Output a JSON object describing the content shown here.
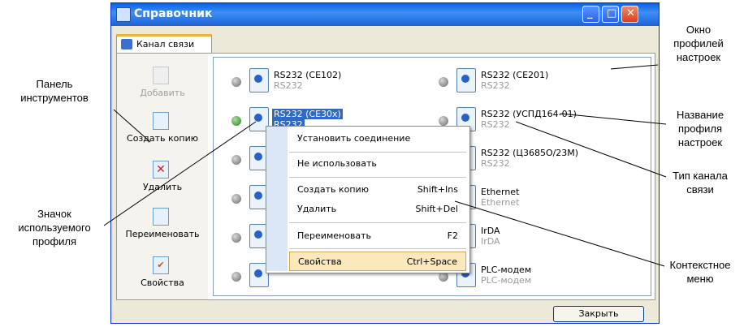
{
  "window": {
    "title": "Справочник",
    "close_label": "Закрыть"
  },
  "tab": {
    "label": "Канал связи"
  },
  "toolbar": [
    {
      "label": "Добавить",
      "disabled": true,
      "icon": "add-icon"
    },
    {
      "label": "Создать копию",
      "icon": "copy-icon"
    },
    {
      "label": "Удалить",
      "icon": "delete-icon"
    },
    {
      "label": "Переименовать",
      "icon": "rename-icon"
    },
    {
      "label": "Свойства",
      "icon": "properties-icon"
    }
  ],
  "profiles_left": [
    {
      "name": "RS232 (CE102)",
      "type": "RS232"
    },
    {
      "name": "RS232 (CE30x)",
      "type": "RS232",
      "selected": true,
      "active": true
    },
    {
      "name": "",
      "type": ""
    },
    {
      "name": "",
      "type": ""
    },
    {
      "name": "",
      "type": ""
    },
    {
      "name": "",
      "type": ""
    }
  ],
  "profiles_right": [
    {
      "name": "RS232 (CE201)",
      "type": "RS232"
    },
    {
      "name": "RS232 (УСПД164-01)",
      "type": "RS232"
    },
    {
      "name": "RS232 (Ц3685О/23М)",
      "type": "RS232"
    },
    {
      "name": "Ethernet",
      "type": "Ethernet"
    },
    {
      "name": "IrDA",
      "type": "IrDA"
    },
    {
      "name": "PLC-модем",
      "type": "PLC-модем"
    }
  ],
  "context_menu": [
    {
      "label": "Установить соединение",
      "shortcut": ""
    },
    {
      "label": "Не использовать",
      "shortcut": ""
    },
    {
      "label": "Создать копию",
      "shortcut": "Shift+Ins"
    },
    {
      "label": "Удалить",
      "shortcut": "Shift+Del"
    },
    {
      "label": "Переименовать",
      "shortcut": "F2"
    },
    {
      "label": "Свойства",
      "shortcut": "Ctrl+Space",
      "highlighted": true
    }
  ],
  "annotations": {
    "toolbar_panel": [
      "Панель",
      "инструментов"
    ],
    "used_profile_icon": [
      "Значок",
      "используемого",
      "профиля"
    ],
    "profiles_window": [
      "Окно",
      "профилей",
      "настроек"
    ],
    "profile_name": [
      "Название",
      "профиля",
      "настроек"
    ],
    "channel_type": [
      "Тип канала",
      "связи"
    ],
    "context_menu": [
      "Контекстное",
      "меню"
    ]
  }
}
